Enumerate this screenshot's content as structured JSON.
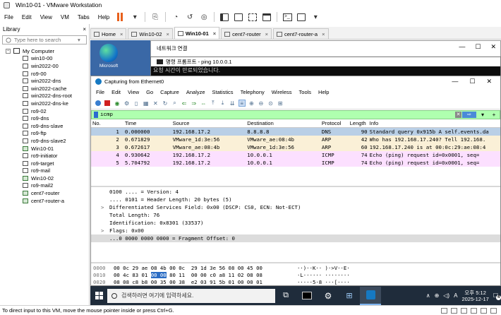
{
  "window": {
    "title": "Win10-01 - VMware Workstation"
  },
  "menu": [
    "File",
    "Edit",
    "View",
    "VM",
    "Tabs",
    "Help"
  ],
  "library": {
    "title": "Library",
    "search_placeholder": "Type here to search",
    "root": "My Computer",
    "items": [
      {
        "label": "win10-00",
        "on": false
      },
      {
        "label": "win2022-00",
        "on": false
      },
      {
        "label": "ro9-00",
        "on": false
      },
      {
        "label": "win2022-dns",
        "on": false
      },
      {
        "label": "win2022-cache",
        "on": false
      },
      {
        "label": "win2022-dns-root",
        "on": false
      },
      {
        "label": "win2022-dns-ke",
        "on": false
      },
      {
        "label": "ro9-02",
        "on": false
      },
      {
        "label": "ro9-dns",
        "on": false
      },
      {
        "label": "ro9-dns-slave",
        "on": false
      },
      {
        "label": "ro9-ftp",
        "on": false
      },
      {
        "label": "ro9-dns-slave2",
        "on": false
      },
      {
        "label": "Win10-01",
        "on": true
      },
      {
        "label": "ro9-initiator",
        "on": false
      },
      {
        "label": "ro9-target",
        "on": false
      },
      {
        "label": "ro9-mail",
        "on": false
      },
      {
        "label": "Win10-02",
        "on": true
      },
      {
        "label": "ro9-mail2",
        "on": false
      },
      {
        "label": "cent7-router",
        "on": true
      },
      {
        "label": "cent7-router-a",
        "on": true
      }
    ]
  },
  "tabs": [
    {
      "label": "Home",
      "active": false
    },
    {
      "label": "Win10-02",
      "active": false
    },
    {
      "label": "Win10-01",
      "active": true
    },
    {
      "label": "cent7-router",
      "active": false
    },
    {
      "label": "cent7-router-a",
      "active": false
    }
  ],
  "guest": {
    "desktop_icon": "Microsoft",
    "network_window_title": "네트워크 연결",
    "cmd_title": "명령 프롬프트 - ping 10.0.0.1",
    "cmd_text": "요청 시간이 만료되었습니다."
  },
  "wireshark": {
    "title": "Capturing from Ethernet0",
    "menu": [
      "File",
      "Edit",
      "View",
      "Go",
      "Capture",
      "Analyze",
      "Statistics",
      "Telephony",
      "Wireless",
      "Tools",
      "Help"
    ],
    "filter": "icmp",
    "columns": {
      "no": "No.",
      "time": "Time",
      "source": "Source",
      "destination": "Destination",
      "protocol": "Protocol",
      "length": "Length",
      "info": "Info"
    },
    "packets": [
      {
        "no": "1",
        "time": "0.000000",
        "src": "192.168.17.2",
        "dst": "8.8.8.8",
        "proto": "DNS",
        "len": "90",
        "info": "Standard query 0x915b A self.events.da",
        "bg": "#dae8f4"
      },
      {
        "no": "2",
        "time": "0.671829",
        "src": "VMware_1d:3e:56",
        "dst": "VMware_ae:08:4b",
        "proto": "ARP",
        "len": "42",
        "info": "Who has 192.168.17.240? Tell 192.168.",
        "bg": "#faf0d7"
      },
      {
        "no": "3",
        "time": "0.672617",
        "src": "VMware_ae:08:4b",
        "dst": "VMware_1d:3e:56",
        "proto": "ARP",
        "len": "60",
        "info": "192.168.17.240 is at 00:0c:29:ae:08:4",
        "bg": "#faf0d7"
      },
      {
        "no": "4",
        "time": "0.930642",
        "src": "192.168.17.2",
        "dst": "10.0.0.1",
        "proto": "ICMP",
        "len": "74",
        "info": "Echo (ping) request  id=0x0001, seq=",
        "bg": "#fce0ff"
      },
      {
        "no": "5",
        "time": "5.704792",
        "src": "192.168.17.2",
        "dst": "10.0.0.1",
        "proto": "ICMP",
        "len": "74",
        "info": "Echo (ping) request  id=0x0001, seq=",
        "bg": "#fce0ff"
      }
    ],
    "details": [
      {
        "indent": 1,
        "text": "0100 .... = Version: 4",
        "exp": ""
      },
      {
        "indent": 1,
        "text": ".... 0101 = Header Length: 20 bytes (5)",
        "exp": ""
      },
      {
        "indent": 0,
        "text": "Differentiated Services Field: 0x00 (DSCP: CS0, ECN: Not-ECT)",
        "exp": ">"
      },
      {
        "indent": 1,
        "text": "Total Length: 76",
        "exp": ""
      },
      {
        "indent": 1,
        "text": "Identification: 0x8301 (33537)",
        "exp": ""
      },
      {
        "indent": 0,
        "text": "Flags: 0x00",
        "exp": ">"
      },
      {
        "indent": 1,
        "text": "...0 0000 0000 0000 = Fragment Offset: 0",
        "exp": ""
      }
    ],
    "bytes": [
      {
        "off": "0000",
        "pre": "00 0c 29 ae 08 4b 00 0c  29 1d 3e 56 08 00 45 00",
        "hl": "",
        "post": "",
        "ascii": "··)··K·· )·>V··E·"
      },
      {
        "off": "0010",
        "pre": "00 4c 83 01 ",
        "hl": "00 00",
        "post": " 80 11  00 00 c0 a8 11 02 08 08",
        "ascii": "·L······ ········"
      },
      {
        "off": "0020",
        "pre": "08 08 c8 b8 00 35 00 38  e2 03 91 5b 01 00 00 01",
        "hl": "",
        "post": "",
        "ascii": "·····5·8 ···[····"
      }
    ]
  },
  "taskbar": {
    "search_placeholder": "검색하려면 여기에 입력하세요.",
    "time": "오후 5:12",
    "date": "2025-12-17",
    "notification_count": "4"
  },
  "statusbar": "To direct input to this VM, move the mouse pointer inside or press Ctrl+G."
}
